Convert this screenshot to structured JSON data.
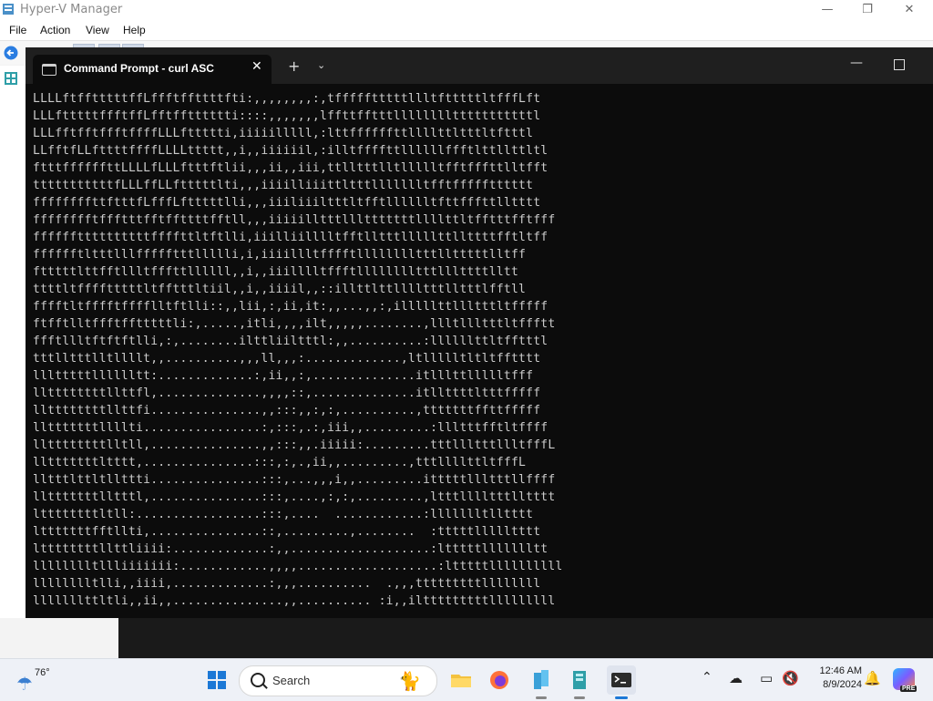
{
  "hyperv": {
    "title": "Hyper-V Manager",
    "menu": [
      "File",
      "Action",
      "View",
      "Help"
    ],
    "window_controls": {
      "minimize": "—",
      "maximize": "❐",
      "close": "✕"
    }
  },
  "terminal": {
    "tab_title": "Command Prompt - curl  ASC",
    "tab_close": "✕",
    "new_tab": "+",
    "dropdown": "⌄",
    "minimize": "—",
    "lines": [
      "LLLLftfftttttffLffftffttttfti:,,,,,,,,:,tffffftttttllltftttttltfffLft",
      "LLLftttttffftffLfftfftttttti::::,,,,,,,lffttfftttlllllllltttttttttttl",
      "LLLfftfftffftffffLLLfttttti,iiiiilllll,:lttffffffttllllttltttltftttl",
      "LLfftfLLfttttffffLLLLttttt,,i,,iiiiiil,:illtffffttllllllffftlttllttltl",
      "ftttffffffttLLLLfLLLftttftlii,,,ii,,iii,ttlltttlltllllltfftfffttlltfft",
      "tttttttttttfLLLffLLftttttlti,,,iiiilliiittltttllllllltfftffffftttttt",
      "ffffffffttftttfLfffLftttttlli,,,iiiliiiltttltfftlllllltfttfffttlltttt",
      "fffffffftffftttfftffttttfftll,,,iiiiilltttllltttttttllllttltfftttfftfff",
      "ffffffttttttttttffffttltftlli,iiilliilllltfftlltttlllllttllttttfftltff",
      "fffffftltttlllffffftttllllli,i,iiiillltfffftlllllllltttlltttttlltff",
      "ftttttlttfftllltfffttllllll,,i,,iiilllltffftlllllllltttlllttttlltt",
      "ttttltfffftttttltfftttltiil,,i,,iiiil,,::illttlttlllltttlltttlfftll",
      "fffftltfffftfffflltftlli::,,lii,:,ii,it:,,...,,:,illlllttllltttltfffff",
      "ftfftlltffftfftttttli:,.....,itli,,,,ilt,,,,,........,llltllltttltffftt",
      "ffftllltftftftlli,:,........ilttliiltttl:,,..........:llllllttltfftttl",
      "tttlltttlltllllt,,..........,,,ll,,,:.............,ltllllltltltfftttt",
      "llltttttlllllltt:.............:,ii,,:,..............itlllttllllltfff",
      "llttttttttllttfl,..............,,,,::,..............itllttttltttfffff",
      "llttttttttllttfi...............,,:::,,:,:,..........,tttttttffttfffff",
      "lltttttttllllti................:,:::,.:,iii,,.........:llltttfftltffff",
      "llttttttttlltll,...............,,:::,,.iiiii:.........tttllltttllltfffL",
      "lltttttttltttt,...............:::,:,.,ii,,.........,tttllllttltfffL",
      "lltttlttltllttti...............:::,...,,,i,,.........itttttllltttllffff",
      "lltttttttlltttl,...............:::,....,:,:,.........,ltttlllltttlltttt",
      "lttttttttltll:.................:::,....  ............:llllllltlltttt",
      "ltttttttfftllti,...............::,.........,........  :tttttllllltttt",
      "lttttttttllttliiii:.............:,,...................:ltttttllllllltt",
      "lllllllltllliiiiiii:............,,,,...................:ltttttllllllllll",
      "lllllllltlli,,iiii,.............:,,,..........  .,,,tttttttttllllllll",
      "lllllllttltli,,ii,,...............,,.......... :i,,iltttttttttlllllllll"
    ]
  },
  "taskbar": {
    "weather_temp": "76°",
    "weather_icon": "cloud-rain-icon",
    "search_placeholder": "Search",
    "time": "12:46 AM",
    "date": "8/9/2024",
    "copilot_badge": "PRE"
  }
}
